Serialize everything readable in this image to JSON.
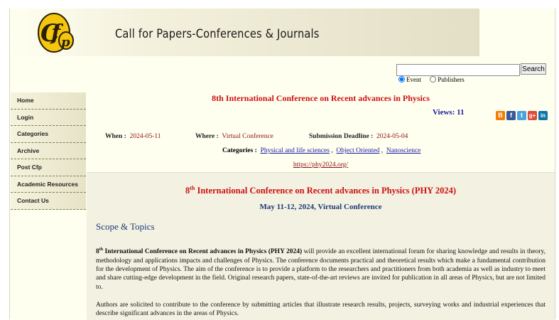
{
  "site": {
    "title": "Call for Papers-Conferences & Journals"
  },
  "search": {
    "button_label": "Search",
    "value": "",
    "options": [
      "Event",
      "Publishers"
    ],
    "selected": "Event"
  },
  "sidebar": {
    "items": [
      "Home",
      "Login",
      "Categories",
      "Archive",
      "Post Cfp",
      "Academic Resources",
      "Contact Us"
    ]
  },
  "conference": {
    "title": "8th International Conference on Recent advances in Physics",
    "views_label": "Views:",
    "views": "11",
    "when_label": "When :",
    "when": "2024-05-11",
    "where_label": "Where :",
    "where": "Virtual Conference",
    "deadline_label": "Submission Deadline :",
    "deadline": "2024-05-04",
    "categories_label": "Categories :",
    "categories": [
      "Physical and life sciences",
      "Object Oriented",
      "Nanoscience"
    ],
    "url": "https://phy2024.org/"
  },
  "share_icons": [
    "blogger-icon",
    "facebook-icon",
    "twitter-icon",
    "google-plus-icon",
    "linkedin-icon"
  ],
  "detail": {
    "heading_ord": "8",
    "heading_sup": "th",
    "heading_rest": " International Conference on Recent advances in Physics (PHY 2024)",
    "dates": "May 11-12, 2024, Virtual Conference",
    "scope_title": "Scope & Topics",
    "p1_ord": "8",
    "p1_sup": "th",
    "p1_bold": " International Conference on Recent advances in Physics (PHY 2024)",
    "p1_rest": " will provide an excellent international forum for sharing knowledge and results in theory, methodology and applications impacts and challenges of Physics. The conference documents practical and theoretical results which make a fundamental contribution for the development of Physics. The aim of the conference is to provide a platform to the researchers and practitioners from both academia as well as industry to meet and share cutting-edge development in the field. Original research papers, state-of-the-art reviews are invited for publication in all areas of Physics, but are not limited to.",
    "p2": "Authors are solicited to contribute to the conference by submitting articles that illustrate research results, projects, surveying works and industrial experiences that describe significant advances in the areas of Physics."
  },
  "colors": {
    "accent_red": "#cc1111",
    "link_blue": "#1a1aa0",
    "heading_blue": "#1e3a78",
    "value_maroon": "#8b1010"
  }
}
